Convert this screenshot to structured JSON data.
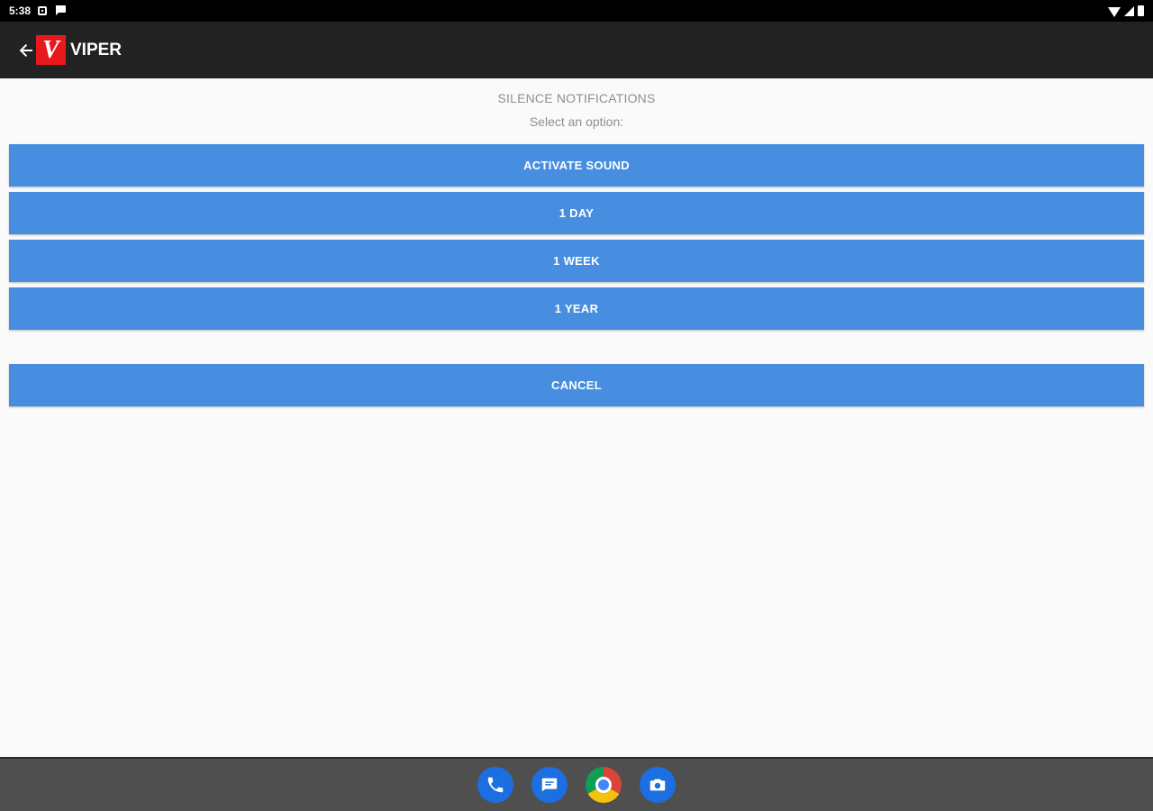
{
  "status_bar": {
    "time": "5:38",
    "icons": [
      "notification-square-icon",
      "notification-chat-icon",
      "wifi-icon",
      "signal-icon",
      "battery-icon"
    ]
  },
  "app_bar": {
    "back_icon": "arrow-left-icon",
    "logo_letter": "V",
    "title": "VIPER",
    "logo_color": "#e8191c",
    "background": "#222222"
  },
  "dialog": {
    "title": "SILENCE NOTIFICATIONS",
    "subtitle": "Select an option:",
    "options": [
      {
        "label": "ACTIVATE SOUND"
      },
      {
        "label": "1 DAY"
      },
      {
        "label": "1 WEEK"
      },
      {
        "label": "1 YEAR"
      }
    ],
    "cancel_label": "CANCEL",
    "button_color": "#478ee0"
  },
  "dock": {
    "apps": [
      "phone-icon",
      "messages-icon",
      "chrome-icon",
      "camera-icon"
    ]
  }
}
